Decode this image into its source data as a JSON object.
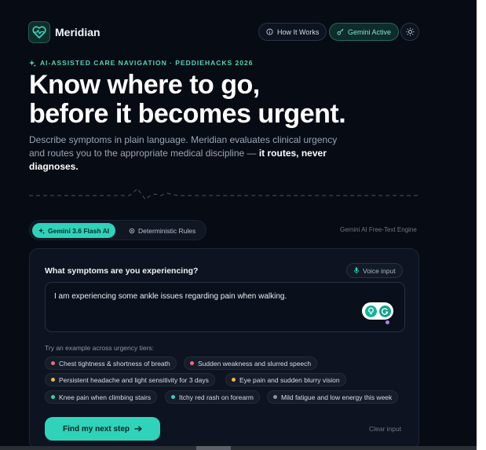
{
  "header": {
    "brand": "Meridian",
    "how_label": "How It Works",
    "gemini_label": "Gemini Active",
    "logo_icon": "heart-pulse-icon",
    "theme_icon": "sun-icon"
  },
  "hero": {
    "eyebrow": "AI-ASSISTED CARE NAVIGATION · PEDDIEHACKS 2026",
    "headline_1": "Know where to go,",
    "headline_2": "before it becomes urgent.",
    "lead_text": "Describe symptoms in plain language. Meridian evaluates clinical urgency and routes you to the appropriate medical discipline — ",
    "lead_bold": "it routes, never diagnoses."
  },
  "modes": {
    "gemini_label": "Gemini 3.6 Flash AI",
    "deterministic_label": "Deterministic Rules",
    "engine_label": "Gemini AI Free-Text Engine"
  },
  "form": {
    "question": "What symptoms are you experiencing?",
    "voice_label": "Voice input",
    "input_value": "I am experiencing some ankle issues regarding pain when walking.",
    "examples_label": "Try an example across urgency tiers:",
    "examples": [
      {
        "text": "Chest tightness & shortness of breath",
        "color": "#f06a80"
      },
      {
        "text": "Sudden weakness and slurred speech",
        "color": "#f06a80"
      },
      {
        "text": "Persistent headache and light sensitivity for 3 days",
        "color": "#f5b544"
      },
      {
        "text": "Eye pain and sudden blurry vision",
        "color": "#f5b544"
      },
      {
        "text": "Knee pain when climbing stairs",
        "color": "#2ed3ba"
      },
      {
        "text": "Itchy red rash on forearm",
        "color": "#2ed3ba"
      },
      {
        "text": "Mild fatigue and low energy this week",
        "color": "#8a95a6"
      }
    ],
    "submit_label": "Find my next step",
    "clear_label": "Clear input"
  },
  "colors": {
    "accent": "#2ed3ba",
    "background": "#070b14",
    "card": "#0d1320"
  }
}
